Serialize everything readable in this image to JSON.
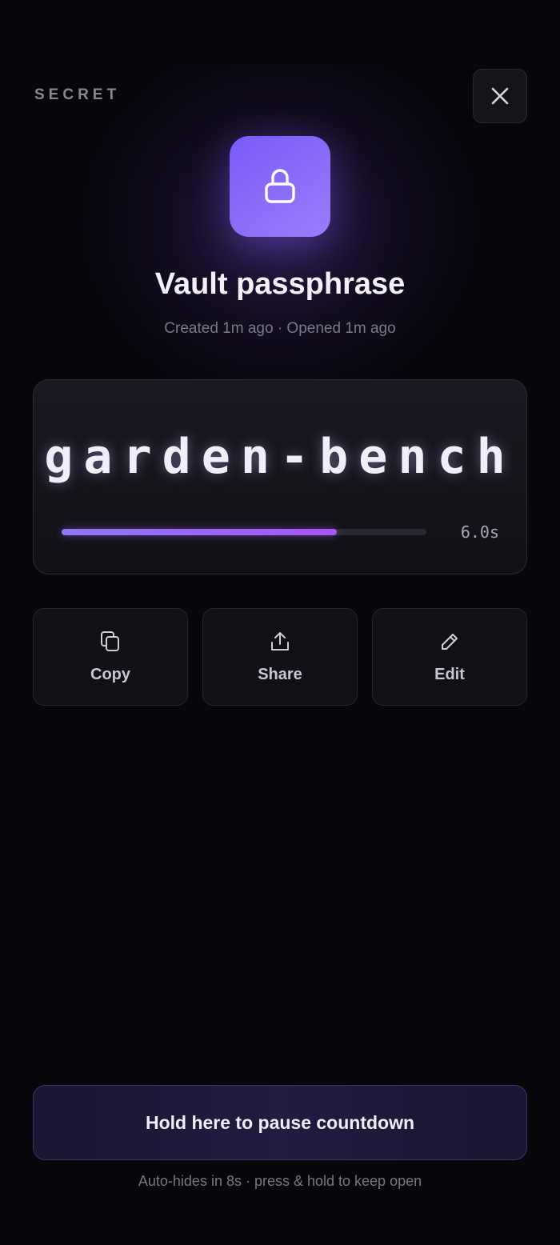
{
  "header": {
    "section_label": "SECRET"
  },
  "close": {
    "icon": "close-icon"
  },
  "item": {
    "icon": "lock-icon",
    "accent_color": "#7a5af8",
    "title": "Vault passphrase",
    "meta": "Created 1m ago · Opened 1m ago"
  },
  "secret": {
    "value": "garden-bench",
    "countdown_progress": 0.755,
    "countdown_label": "6.0s"
  },
  "actions": [
    {
      "icon": "copy-icon",
      "label": "Copy"
    },
    {
      "icon": "share-icon",
      "label": "Share"
    },
    {
      "icon": "edit-icon",
      "label": "Edit"
    }
  ],
  "hold_button": {
    "label": "Hold here to pause countdown"
  },
  "footnote": "Auto-hides in 8s · press & hold to keep open"
}
